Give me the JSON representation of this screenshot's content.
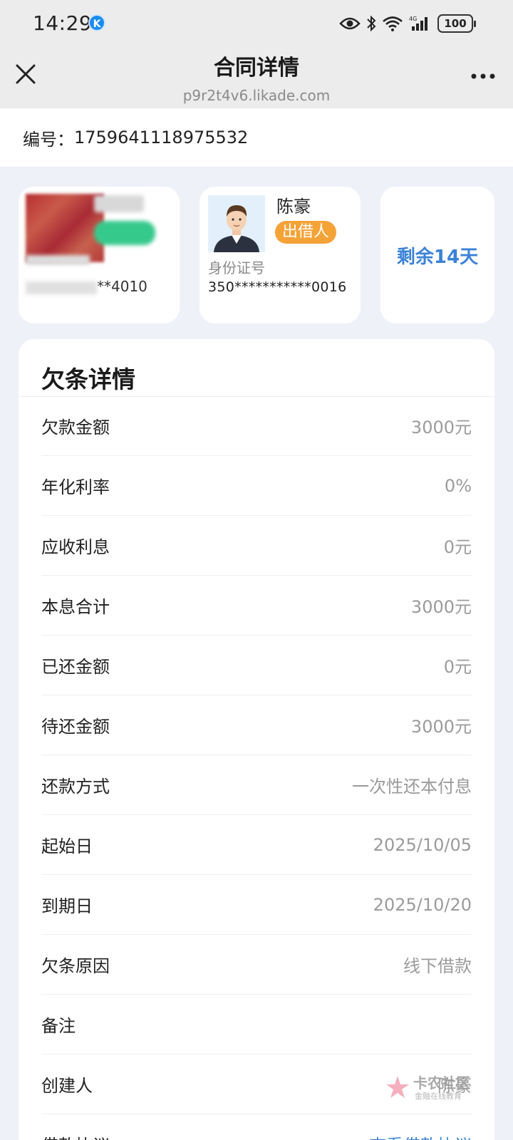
{
  "status": {
    "time": "14:29",
    "app_badge": "K",
    "battery": "100"
  },
  "header": {
    "title": "合同详情",
    "url": "p9r2t4v6.likade.com"
  },
  "contract": {
    "label": "编号：",
    "number": "1759641118975532"
  },
  "party_a": {
    "id_suffix": "**4010"
  },
  "party_b": {
    "name": "陈豪",
    "role": "出借人",
    "id_label": "身份证号",
    "id_number": "350***********0016"
  },
  "remaining": "剩余14天",
  "details": {
    "title": "欠条详情",
    "rows": [
      {
        "label": "欠款金额",
        "value": "3000元"
      },
      {
        "label": "年化利率",
        "value": "0%"
      },
      {
        "label": "应收利息",
        "value": "0元"
      },
      {
        "label": "本息合计",
        "value": "3000元"
      },
      {
        "label": "已还金额",
        "value": "0元"
      },
      {
        "label": "待还金额",
        "value": "3000元"
      },
      {
        "label": "还款方式",
        "value": "一次性还本付息"
      },
      {
        "label": "起始日",
        "value": "2025/10/05"
      },
      {
        "label": "到期日",
        "value": "2025/10/20"
      },
      {
        "label": "欠条原因",
        "value": "线下借款"
      },
      {
        "label": "备注",
        "value": ""
      },
      {
        "label": "创建人",
        "value": "陈豪"
      },
      {
        "label": "借款协议",
        "value": "查看借款协议"
      }
    ]
  },
  "watermark": {
    "text": "卡农社区",
    "sub": "金融在线教育"
  },
  "colors": {
    "accent": "#3b82d6",
    "lender_tag": "#f5a236"
  }
}
